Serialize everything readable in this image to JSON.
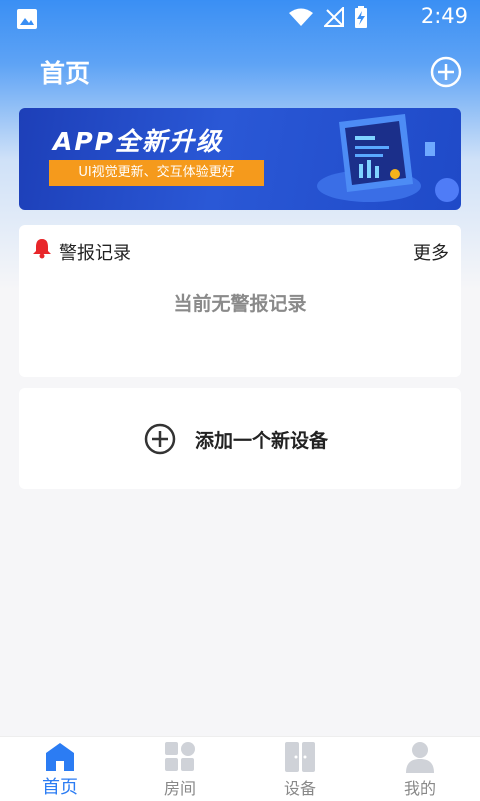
{
  "status_bar": {
    "time": "2:49"
  },
  "header": {
    "title": "首页"
  },
  "banner": {
    "headline": "APP全新升级",
    "tagline": "UI视觉更新、交互体验更好"
  },
  "alarm_card": {
    "title": "警报记录",
    "more_label": "更多",
    "empty_text": "当前无警报记录"
  },
  "add_device": {
    "label": "添加一个新设备"
  },
  "bottom_nav": {
    "items": [
      {
        "label": "首页",
        "icon": "home-icon",
        "active": true
      },
      {
        "label": "房间",
        "icon": "room-icon",
        "active": false
      },
      {
        "label": "设备",
        "icon": "device-icon",
        "active": false
      },
      {
        "label": "我的",
        "icon": "profile-icon",
        "active": false
      }
    ]
  },
  "colors": {
    "accent": "#2b7cf3",
    "header_blue": "#3a8ff4",
    "banner_tag": "#f59a1c",
    "alarm_red": "#e8262a"
  }
}
